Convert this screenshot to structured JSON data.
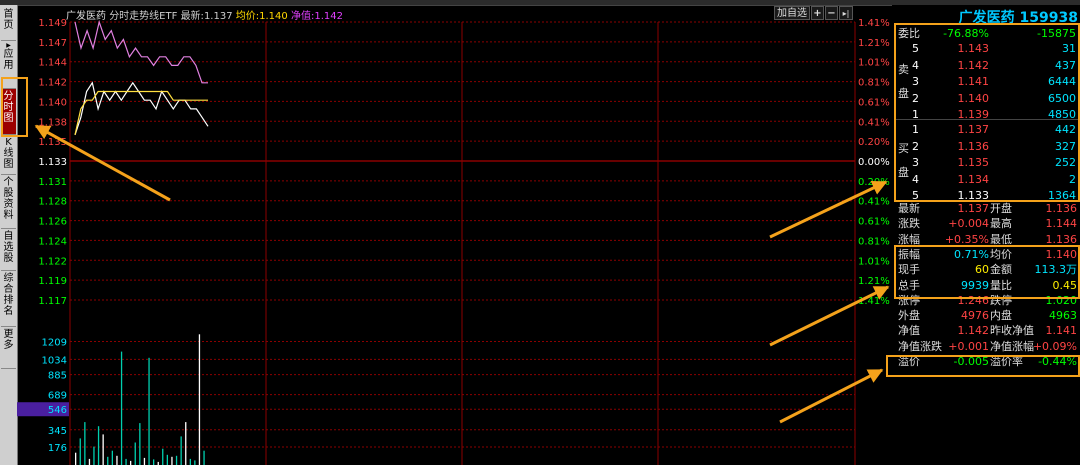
{
  "sidebar": {
    "tabs": [
      {
        "label": "首页"
      },
      {
        "label": "应用"
      },
      {
        "label": "分时图"
      },
      {
        "label": "K线图"
      },
      {
        "label": "个股资料"
      },
      {
        "label": "自选股"
      },
      {
        "label": "综合排名"
      },
      {
        "label": "更多"
      }
    ]
  },
  "header": {
    "name": "广发医药",
    "chart_name": "分时走势线ETF",
    "latest_label": "最新:",
    "latest_value": "1.137",
    "avg_label": "均价:",
    "avg_value": "1.140",
    "nav_label": "净值:",
    "nav_value": "1.142"
  },
  "toolbar": {
    "add_watch_label": "加自选",
    "plus": "+",
    "minus": "−",
    "last": "▸|"
  },
  "chart_data": {
    "type": "line",
    "price_axis": {
      "labels": [
        "1.149",
        "1.147",
        "1.144",
        "1.142",
        "1.140",
        "1.138",
        "1.135",
        "1.133",
        "1.131",
        "1.128",
        "1.126",
        "1.124",
        "1.122",
        "1.119",
        "1.117"
      ],
      "percents": [
        "1.41%",
        "1.21%",
        "1.01%",
        "0.81%",
        "0.61%",
        "0.41%",
        "0.20%",
        "0.00%",
        "0.20%",
        "0.41%",
        "0.61%",
        "0.81%",
        "1.01%",
        "1.21%",
        "1.41%"
      ],
      "ylim": [
        1.117,
        1.149
      ],
      "prev_close": 1.133
    },
    "volume_axis": {
      "labels": [
        "1209",
        "1034",
        "885",
        "689",
        "546",
        "345",
        "176"
      ],
      "ylim": [
        0,
        1400
      ],
      "highlighted": "546"
    },
    "series": [
      {
        "values": [
          1.149,
          1.146,
          1.148,
          1.146,
          1.149,
          1.147,
          1.148,
          1.146,
          1.147,
          1.145,
          1.146,
          1.145,
          1.145,
          1.144,
          1.145,
          1.145,
          1.144,
          1.144,
          1.145,
          1.145,
          1.144,
          1.142,
          1.142
        ],
        "color": "#e080e0"
      },
      {
        "values": [
          1.136,
          1.138,
          1.141,
          1.142,
          1.139,
          1.141,
          1.14,
          1.141,
          1.14,
          1.141,
          1.142,
          1.141,
          1.14,
          1.14,
          1.139,
          1.141,
          1.14,
          1.139,
          1.14,
          1.14,
          1.139,
          1.139,
          1.138,
          1.137
        ],
        "color": "#ffffff"
      },
      {
        "values": [
          1.136,
          1.139,
          1.14,
          1.14,
          1.141,
          1.141,
          1.141,
          1.141,
          1.141,
          1.141,
          1.141,
          1.141,
          1.141,
          1.141,
          1.141,
          1.141,
          1.141,
          1.14,
          1.14,
          1.14,
          1.14,
          1.14,
          1.14,
          1.14
        ],
        "color": "#ffe040"
      }
    ],
    "volume": [
      120,
      260,
      420,
      60,
      180,
      380,
      300,
      80,
      140,
      90,
      1110,
      60,
      40,
      220,
      410,
      70,
      1050,
      55,
      30,
      160,
      100,
      80,
      90,
      280,
      420,
      60,
      45,
      1280,
      140
    ]
  },
  "quote": {
    "title": "广发医药 159938",
    "ratio_label": "委比",
    "ratio_pct": "-76.88%",
    "ratio_val": "-15875",
    "sell_label": "卖盘",
    "buy_label": "买盘",
    "asks": [
      {
        "lvl": "5",
        "price": "1.143",
        "vol": "31"
      },
      {
        "lvl": "4",
        "price": "1.142",
        "vol": "437"
      },
      {
        "lvl": "3",
        "price": "1.141",
        "vol": "6444"
      },
      {
        "lvl": "2",
        "price": "1.140",
        "vol": "6500"
      },
      {
        "lvl": "1",
        "price": "1.139",
        "vol": "4850"
      }
    ],
    "bids": [
      {
        "lvl": "1",
        "price": "1.137",
        "vol": "442"
      },
      {
        "lvl": "2",
        "price": "1.136",
        "vol": "327"
      },
      {
        "lvl": "3",
        "price": "1.135",
        "vol": "252"
      },
      {
        "lvl": "4",
        "price": "1.134",
        "vol": "2"
      },
      {
        "lvl": "5",
        "price": "1.133",
        "vol": "1364"
      }
    ],
    "stats": [
      {
        "l1": "最新",
        "v1": "1.137",
        "c1": "#ff4444",
        "l2": "开盘",
        "v2": "1.136",
        "c2": "#ff4444"
      },
      {
        "l1": "涨跌",
        "v1": "+0.004",
        "c1": "#ff4444",
        "l2": "最高",
        "v2": "1.144",
        "c2": "#ff4444"
      },
      {
        "l1": "涨幅",
        "v1": "+0.35%",
        "c1": "#ff4444",
        "l2": "最低",
        "v2": "1.136",
        "c2": "#ff4444"
      },
      {
        "l1": "振幅",
        "v1": "0.71%",
        "c1": "#00e5ff",
        "l2": "均价",
        "v2": "1.140",
        "c2": "#ff4444"
      },
      {
        "l1": "现手",
        "v1": "60",
        "c1": "#ffee00",
        "l2": "金额",
        "v2": "113.3万",
        "c2": "#00e5ff"
      },
      {
        "l1": "总手",
        "v1": "9939",
        "c1": "#00e5ff",
        "l2": "量比",
        "v2": "0.45",
        "c2": "#ffee00"
      },
      {
        "l1": "涨停",
        "v1": "1.246",
        "c1": "#ff4444",
        "l2": "跌停",
        "v2": "1.020",
        "c2": "#00ff00"
      },
      {
        "l1": "外盘",
        "v1": "4976",
        "c1": "#ff4444",
        "l2": "内盘",
        "v2": "4963",
        "c2": "#00ff00"
      },
      {
        "l1": "净值",
        "v1": "1.142",
        "c1": "#ff4444",
        "l2": "昨收净值",
        "v2": "1.141",
        "c2": "#ff4444"
      },
      {
        "l1": "净值涨跌",
        "v1": "+0.001",
        "c1": "#ff4444",
        "l2": "净值涨幅",
        "v2": "+0.09%",
        "c2": "#ff4444"
      },
      {
        "l1": "溢价",
        "v1": "-0.005",
        "c1": "#00ff00",
        "l2": "溢价率",
        "v2": "-0.44%",
        "c2": "#00ff00"
      }
    ]
  },
  "colors": {
    "up": "#ff4444",
    "down": "#00ff00",
    "grid": "#8b0000",
    "highlight": "#f4a21b",
    "title": "#00c8ff"
  }
}
